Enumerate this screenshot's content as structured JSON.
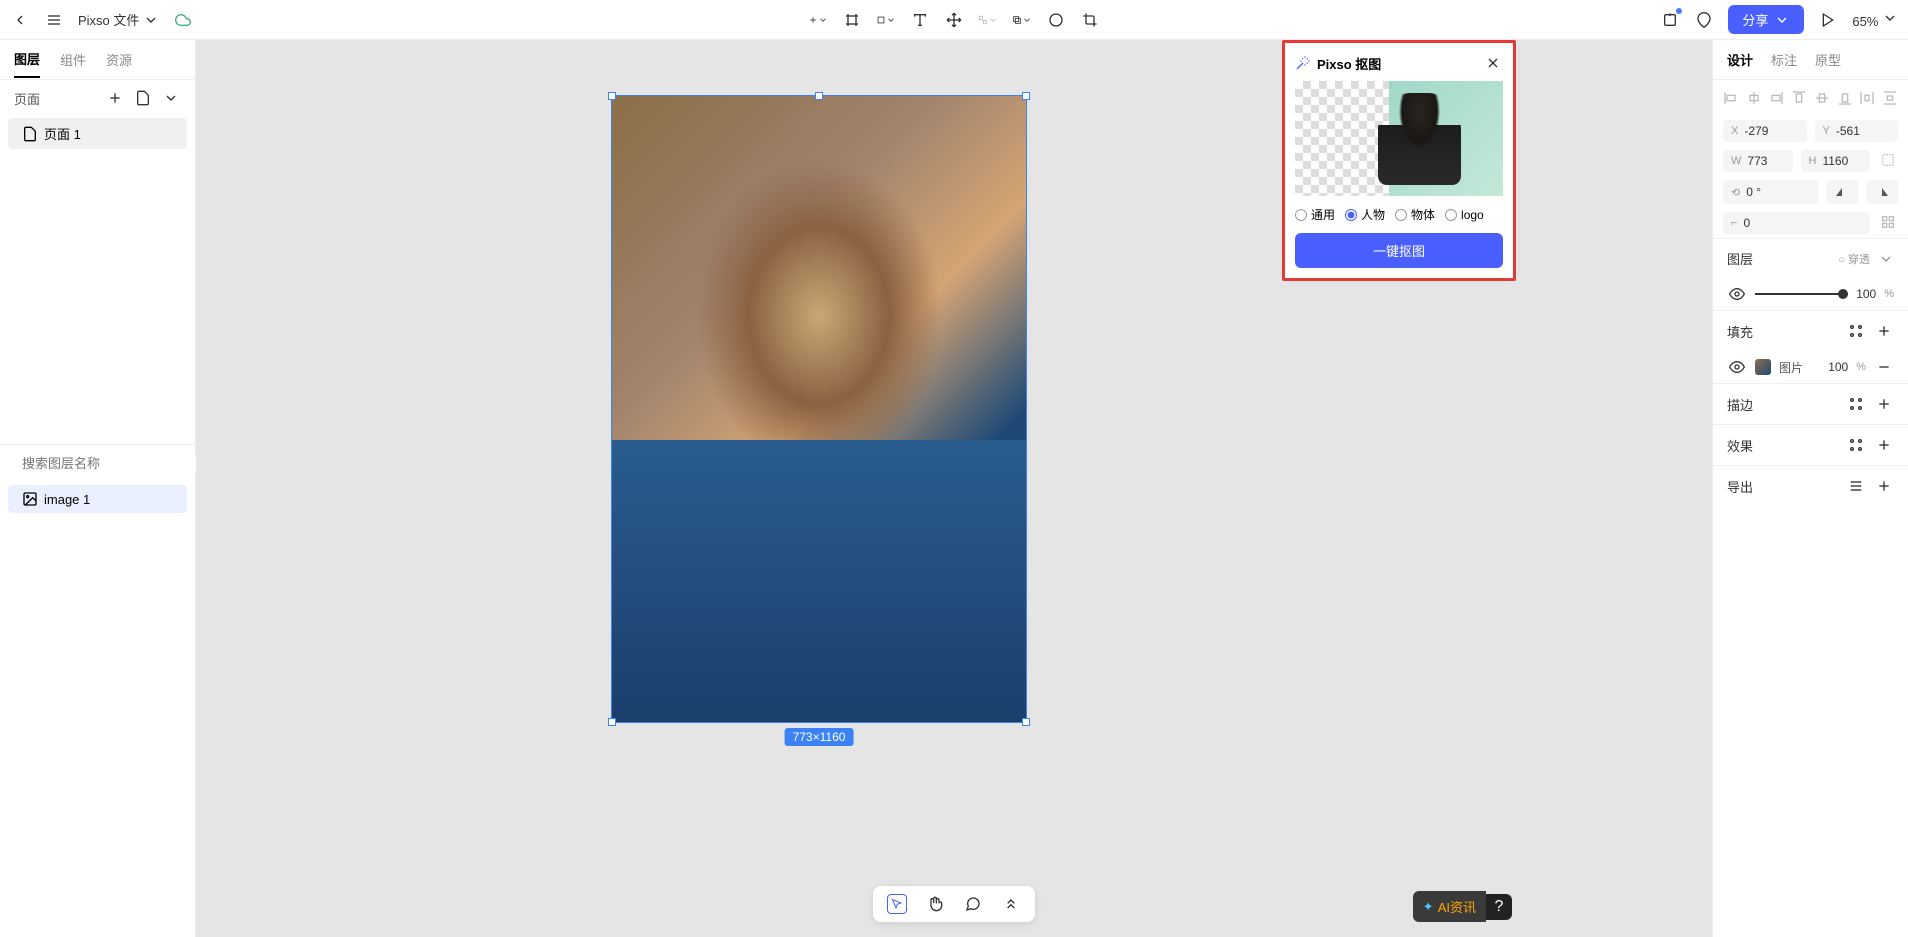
{
  "header": {
    "file_title": "Pixso 文件",
    "zoom": "65%",
    "share_label": "分享"
  },
  "left_panel": {
    "tabs": [
      "图层",
      "组件",
      "资源"
    ],
    "active_tab": 0,
    "pages_label": "页面",
    "pages": [
      "页面 1"
    ],
    "search_placeholder": "搜索图层名称",
    "layers": [
      "image 1"
    ]
  },
  "canvas": {
    "size_label": "773×1160"
  },
  "cutout": {
    "title": "Pixso 抠图",
    "options": [
      "通用",
      "人物",
      "物体",
      "logo"
    ],
    "selected": 1,
    "action_label": "一键抠图"
  },
  "right_panel": {
    "tabs": [
      "设计",
      "标注",
      "原型"
    ],
    "active_tab": 0,
    "x": "-279",
    "y": "-561",
    "w": "773",
    "h": "1160",
    "rotation": "0 °",
    "corner": "0",
    "layer_label": "图层",
    "pass_through": "穿透",
    "opacity": "100",
    "fill_label": "填充",
    "fill_type": "图片",
    "fill_opacity": "100",
    "stroke_label": "描边",
    "effect_label": "效果",
    "export_label": "导出"
  },
  "bottom_toolbar": {
    "ai_label": "AI资讯"
  }
}
